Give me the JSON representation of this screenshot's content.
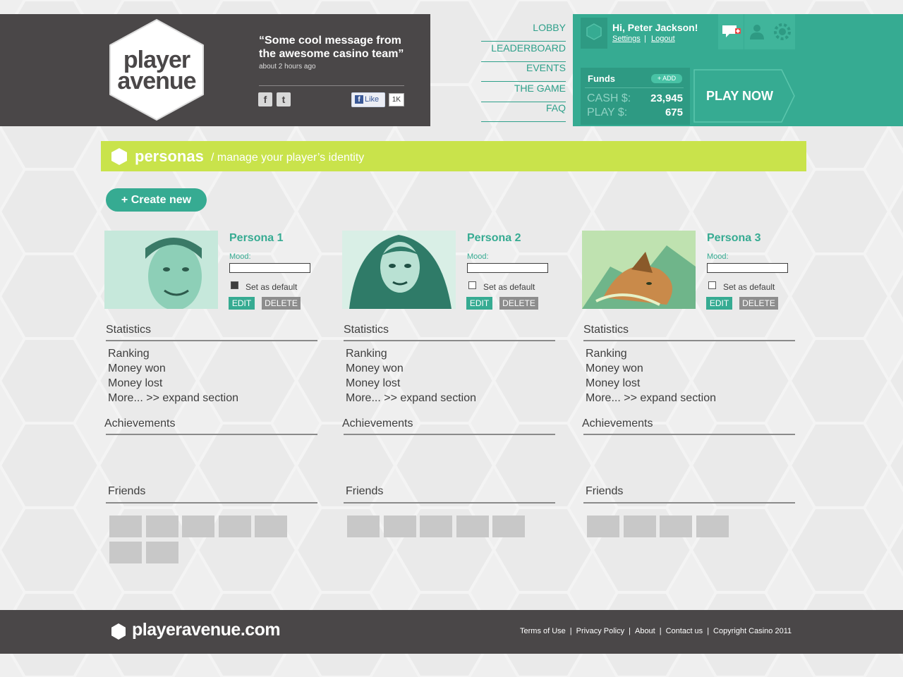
{
  "brand": {
    "logo_line1": "player",
    "logo_line2": "avenue",
    "footer_logo": "playeravenue.com"
  },
  "message": {
    "text": "“Some cool message from the awesome casino team”",
    "time": "about 2 hours ago"
  },
  "social": {
    "facebook_icon": "f",
    "twitter_icon": "t",
    "like_label": "Like",
    "like_count": "1K"
  },
  "nav": {
    "items": [
      {
        "label": "LOBBY"
      },
      {
        "label": "LEADERBOARD"
      },
      {
        "label": "EVENTS"
      },
      {
        "label": "THE GAME"
      },
      {
        "label": "FAQ"
      }
    ]
  },
  "user": {
    "greeting": "Hi, Peter Jackson!",
    "settings_label": "Settings",
    "separator": "|",
    "logout_label": "Logout"
  },
  "funds": {
    "label": "Funds",
    "add_label": "+ ADD",
    "cash_label": "CASH $:",
    "cash_value": "23,945",
    "play_label": "PLAY $:",
    "play_value": "675"
  },
  "play_now_label": "PLAY NOW",
  "page": {
    "title": "personas",
    "subtitle": "/ manage your player’s identity",
    "create_label": "+ Create new"
  },
  "persona_labels": {
    "mood": "Mood:",
    "set_default": "Set as default",
    "edit": "EDIT",
    "delete": "DELETE",
    "statistics": "Statistics",
    "ranking": "Ranking",
    "money_won": "Money won",
    "money_lost": "Money lost",
    "more": "More... >> expand section",
    "achievements": "Achievements",
    "friends": "Friends"
  },
  "personas": [
    {
      "name": "Persona 1",
      "is_default": true,
      "friend_count": 7
    },
    {
      "name": "Persona 2",
      "is_default": false,
      "friend_count": 5
    },
    {
      "name": "Persona 3",
      "is_default": false,
      "friend_count": 4
    }
  ],
  "footer": {
    "links": [
      "Terms of Use",
      "Privacy Policy",
      "About",
      "Contact us",
      "Copyright Casino 2011"
    ]
  },
  "colors": {
    "teal": "#36ab92",
    "lime": "#c9e34b",
    "dark": "#4a4748"
  }
}
